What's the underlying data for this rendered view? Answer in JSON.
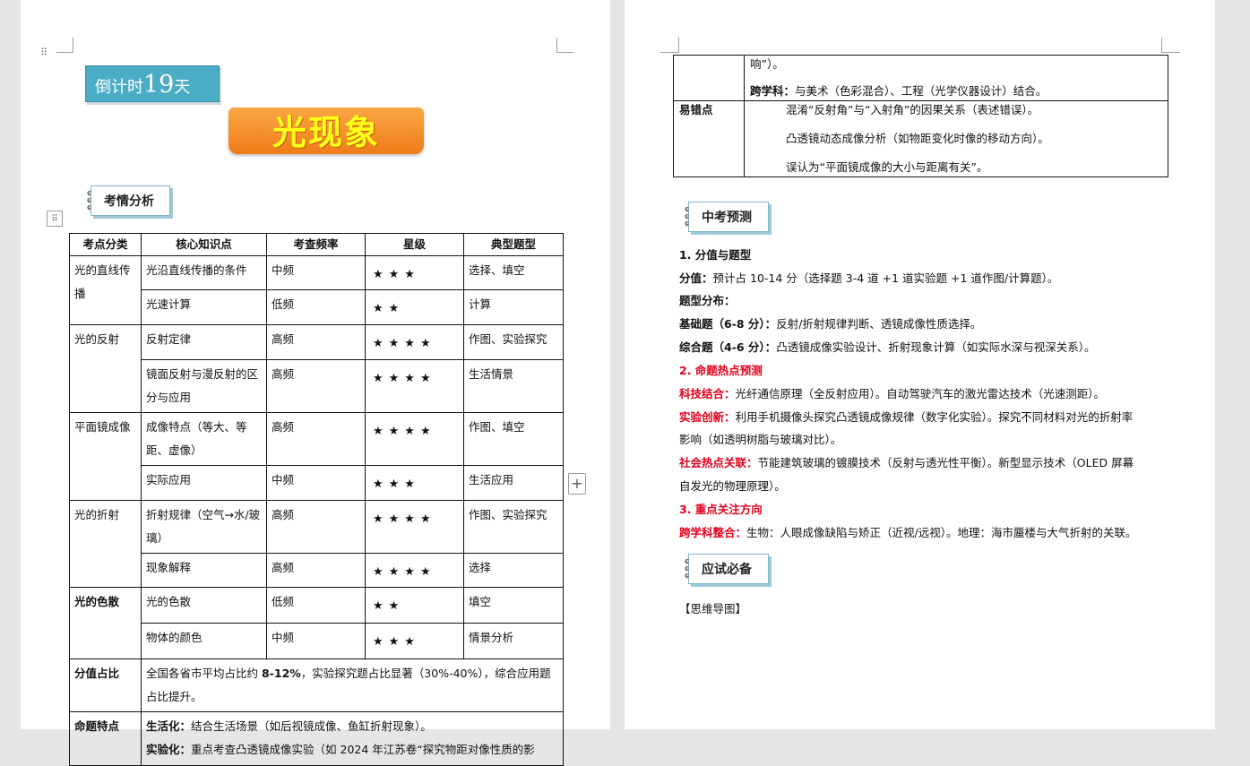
{
  "left_page": {
    "countdown": {
      "prefix": "倒计时",
      "number": "19",
      "suffix": "天"
    },
    "banner_title": "光现象",
    "section_exam_analysis": "考情分析",
    "table": {
      "headers": [
        "考点分类",
        "核心知识点",
        "考查频率",
        "星级",
        "典型题型"
      ],
      "rows": [
        {
          "cat": "光的直线传播",
          "point": "光沿直线传播的条件",
          "freq": "中频",
          "stars": "★★★",
          "type": "选择、填空"
        },
        {
          "point": "光速计算",
          "freq": "低频",
          "stars": "★★",
          "type": "计算"
        },
        {
          "cat": "光的反射",
          "point": "反射定律",
          "freq": "高频",
          "stars": "★★★★",
          "type": "作图、实验探究"
        },
        {
          "point": "镜面反射与漫反射的区分与应用",
          "freq": "高频",
          "stars": "★★★★",
          "type": "生活情景"
        },
        {
          "cat": "平面镜成像",
          "point": "成像特点（等大、等距、虚像）",
          "freq": "高频",
          "stars": "★★★★",
          "type": "作图、填空"
        },
        {
          "point": "实际应用",
          "freq": "中频",
          "stars": "★★★",
          "type": "生活应用"
        },
        {
          "cat": "光的折射",
          "point": "折射规律（空气→水/玻璃）",
          "freq": "高频",
          "stars": "★★★★",
          "type": "作图、实验探究"
        },
        {
          "point": "现象解释",
          "freq": "高频",
          "stars": "★★★★",
          "type": "选择"
        },
        {
          "cat": "光的色散",
          "point": "光的色散",
          "freq": "低频",
          "stars": "★★",
          "type": "填空"
        },
        {
          "point": "物体的颜色",
          "freq": "中频",
          "stars": "★★★",
          "type": "情景分析"
        }
      ],
      "score_label": "分值占比",
      "score_text_a": "全国各省市平均占比约 ",
      "score_text_b": "8-12%",
      "score_text_c": "，实验探究题占比显著（30%-40%），综合应用题占比提升。",
      "feature_label": "命题特点",
      "feature_1_label": "生活化：",
      "feature_1_text": "结合生活场景（如后视镜成像、鱼缸折射现象）。",
      "feature_2_label": "实验化：",
      "feature_2_text": "重点考查凸透镜成像实验（如 2024 年江苏卷“探究物距对像性质的影"
    }
  },
  "right_page": {
    "cont_table": {
      "row1_line1": "响”）。",
      "row1_label": "跨学科：",
      "row1_text": "与美术（色彩混合）、工程（光学仪器设计）结合。",
      "row2_label": "易错点",
      "row2_items": [
        "混淆“反射角”与“入射角”的因果关系（表述错误）。",
        "凸透镜动态成像分析（如物距变化时像的移动方向）。",
        "误认为“平面镜成像的大小与距离有关”。"
      ]
    },
    "section_forecast": "中考预测",
    "h1": "1.  分值与题型",
    "score_label": "分值：",
    "score_text": "预计占 10-14 分（选择题 3-4 道 +1 道实验题 +1 道作图/计算题）。",
    "dist_label": "题型分布：",
    "basic_label": "基础题（6-8 分）：",
    "basic_text": "反射/折射规律判断、透镜成像性质选择。",
    "comp_label": "综合题（4-6 分）：",
    "comp_text": "凸透镜成像实验设计、折射现象计算（如实际水深与视深关系）。",
    "h2": "2.  命题热点预测",
    "tech_label": "科技结合：",
    "tech_text": "光纤通信原理（全反射应用）。自动驾驶汽车的激光雷达技术（光速测距）。",
    "exp_label": "实验创新：",
    "exp_text": "利用手机摄像头探究凸透镜成像规律（数字化实验）。探究不同材料对光的折射率",
    "exp_text2": "影响（如透明树脂与玻璃对比）。",
    "social_label": "社会热点关联：",
    "social_text": "节能建筑玻璃的镀膜技术（反射与透光性平衡）。新型显示技术（OLED 屏幕",
    "social_text2": "自发光的物理原理）。",
    "h3": "3.  重点关注方向",
    "cross_label": "跨学科整合：",
    "cross_text": "生物：人眼成像缺陷与矫正（近视/远视）。地理：海市蜃楼与大气折射的关联。",
    "section_must": "应试必备",
    "mindmap": "【思维导图】"
  },
  "icons": {
    "drag": "drag-handle-icon",
    "move": "table-move-icon",
    "add": "plus-icon"
  }
}
